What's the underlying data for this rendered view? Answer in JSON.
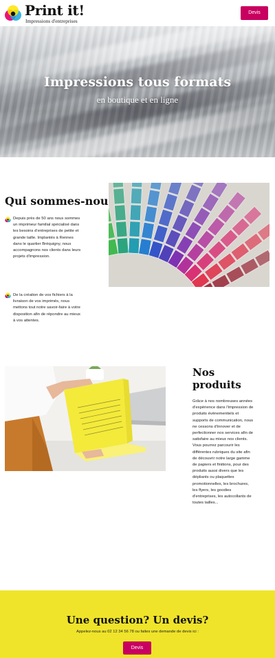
{
  "header": {
    "logo_title": "Print it!",
    "logo_subtitle": "Impressions d'entreprises",
    "devis_button": "Devis"
  },
  "hero": {
    "title": "Impressions tous formats",
    "subtitle": "en boutique et en ligne"
  },
  "about": {
    "title": "Qui sommes-nous ?",
    "paragraphs": [
      "Depuis près de 50 ans nous sommes un imprimeur familial spécialisé dans les besoins d'entreprises de petite et grande taille. Implantés à Rennes dans le quartier Bréquigny, nous accompagnons nos clients dans leurs projets d'impression.",
      "De la création de vos fichiers à la livraison de vos imprimés, nous mettons tout notre savoir-faire à votre disposition afin de répondre au mieux à vos attentes."
    ]
  },
  "products": {
    "title": "Nos produits",
    "text": "Grâce à nos nombreuses années d'expérience dans l'impression de produits évènementiels et supports de communication, nous ne cessons d'innover et de perfectionner nos services afin de satisfaire au mieux nos clients. Vous pourrez parcourir les différentes rubriques du site afin de découvrir notre large gamme de papiers et finitions, pour des produits aussi divers que les dépliants ou plaquettes promotionnelles, les brochures, les flyers, les goodies d'entreprises, les autocollants de toutes tailles..."
  },
  "cta": {
    "title": "Une question? Un devis?",
    "text": "Appelez-nous au 02 12 34 56 78 ou faites une demande de devis ici :",
    "button": "Devis"
  },
  "colors": {
    "accent": "#c8005f",
    "cta_background": "#efe42a",
    "logo_cyan": "#1aa7e0",
    "logo_magenta": "#e5006d",
    "logo_yellow": "#ffe600"
  }
}
